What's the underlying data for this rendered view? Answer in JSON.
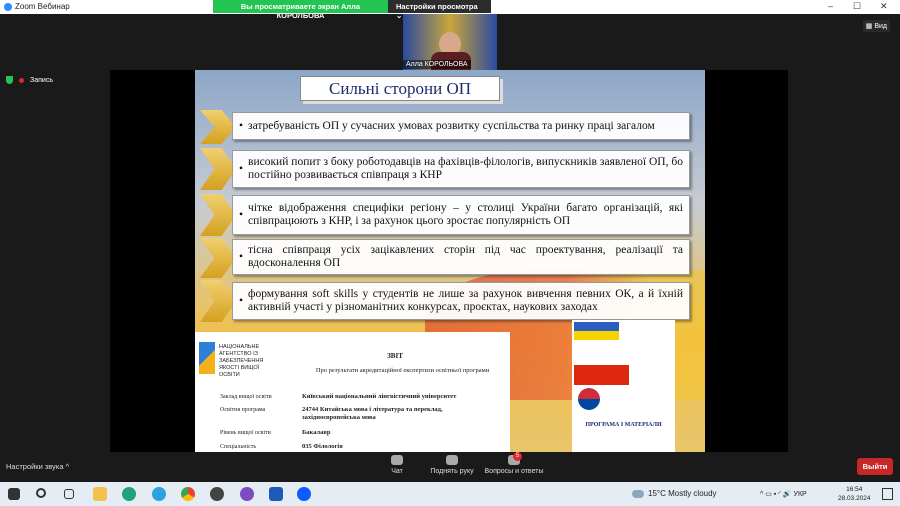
{
  "window": {
    "title": "Zoom Вебинар",
    "minimize": "–",
    "maximize": "☐",
    "close": "✕"
  },
  "share_banner": {
    "viewing": "Вы просматриваете экран Алла КОРОЛЬОВА",
    "view_options": "Настройки просмотра ⌄"
  },
  "video": {
    "name": "Алла КОРОЛЬОВА"
  },
  "view_button": "Вид",
  "recording": "Запись",
  "slide": {
    "title": "Сильні сторони ОП",
    "bullets": [
      "затребуваність ОП у сучасних умовах розвитку суспільства та ринку праці загалом",
      "високий попит з боку роботодавців на фахівців-філологів, випускників заявленої ОП, бо постійно розвивається співпраця з КНР",
      "чітке відображення специфіки регіону – у столиці України багато організацій, які співпрацюють з КНР, і за рахунок цього зростає популярність ОП",
      "тісна співпраця усіх зацікавлених сторін під час проектування, реалізації та вдосконалення ОП",
      "формування soft skills у студентів не лише за рахунок вивчення певних ОК, а й їхній активній участі у різноманітних конкурсах, проєктах, наукових заходах"
    ],
    "report": {
      "agency": "НАЦІОНАЛЬНЕ АГЕНТСТВО ІЗ ЗАБЕЗПЕЧЕННЯ ЯКОСТІ ВИЩОЇ ОСВІТИ",
      "title": "ЗВІТ",
      "subtitle": "Про результати акредитаційної експертизи освітньої програми",
      "rows": [
        {
          "label": "Заклад вищої освіти",
          "value": "Київський національний лінгвістичний університет"
        },
        {
          "label": "Освітня програма",
          "value": "24744 Китайська мова і література та переклад, західноєвропейська мова"
        },
        {
          "label": "Рівень вищої освіти",
          "value": "Бакалавр"
        },
        {
          "label": "Спеціальність",
          "value": "035 Філологія"
        }
      ]
    },
    "poster_title": "ПРОГРАМА І МАТЕРІАЛИ"
  },
  "controls": {
    "audio": "Настройки звука ^",
    "chat": "Чат",
    "raise_hand": "Поднять руку",
    "qa": "Вопросы и ответы",
    "qa_badge": "5",
    "leave": "Выйти"
  },
  "taskbar": {
    "weather": "15°C  Mostly cloudy",
    "lang": "УКР",
    "time": "16:54",
    "date": "28.03.2024"
  }
}
